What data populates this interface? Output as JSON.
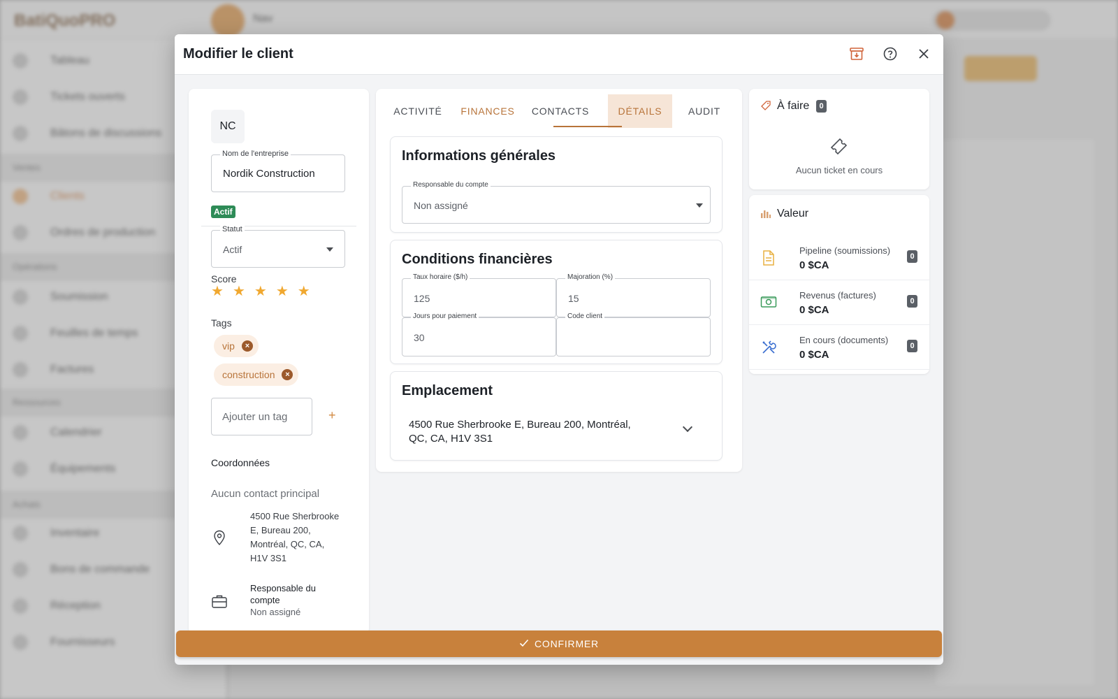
{
  "background": {
    "logo_text": "BatiQuoPRO",
    "top_text": "Nav",
    "nav_items": [
      "Tableau",
      "Tickets ouverts",
      "Bâtons de discussions",
      "Clients",
      "Ordres de production",
      "Soumission",
      "Feuilles de temps",
      "Factures",
      "Calendrier",
      "Équipements",
      "Inventaire",
      "Bons de commande",
      "Réception",
      "Fournisseurs"
    ],
    "nav_sections": [
      "Ventes",
      "Opérations",
      "Ressources",
      "Achats"
    ]
  },
  "modal": {
    "title": "Modifier le client",
    "header_icons": [
      "archive-icon",
      "help-icon",
      "close-icon"
    ]
  },
  "left": {
    "initials": "NC",
    "company_label": "Nom de l'entreprise",
    "company_value": "Nordik Construction",
    "status_badge": "Actif",
    "status_label": "Statut",
    "status_value": "Actif",
    "score_label": "Score",
    "score": 5,
    "tags_label": "Tags",
    "tags": [
      "vip",
      "construction"
    ],
    "tag_placeholder": "Ajouter un tag",
    "tag_add": "+",
    "coords_label": "Coordonnées",
    "no_contact": "Aucun contact principal",
    "address_lines": [
      "4500 Rue Sherbrooke",
      "E, Bureau 200,",
      "Montréal, QC, CA,",
      "H1V 3S1"
    ],
    "manager_label_lines": [
      "Responsable du",
      "compte"
    ],
    "manager_value": "Non assigné"
  },
  "tabs": [
    {
      "label": "ACTIVITÉ",
      "state": "normal"
    },
    {
      "label": "FINANCES",
      "state": "accent"
    },
    {
      "label": "CONTACTS",
      "state": "normal"
    },
    {
      "label": "DÉTAILS",
      "state": "active"
    },
    {
      "label": "AUDIT",
      "state": "normal"
    }
  ],
  "general": {
    "title": "Informations générales",
    "manager_label": "Responsable du compte",
    "manager_value": "Non assigné"
  },
  "finance": {
    "title": "Conditions financières",
    "hourly_label": "Taux horaire ($/h)",
    "hourly_value": "125",
    "markup_label": "Majoration (%)",
    "markup_value": "15",
    "payment_label": "Jours pour paiement",
    "payment_value": "30",
    "client_code_label": "Code client",
    "client_code_value": ""
  },
  "location": {
    "title": "Emplacement",
    "address_line1": "4500 Rue Sherbrooke E, Bureau 200, Montréal,",
    "address_line2": "QC, CA, H1V 3S1"
  },
  "todo": {
    "title": "À faire",
    "count": "0",
    "empty_text": "Aucun ticket en cours"
  },
  "value": {
    "title": "Valeur",
    "rows": [
      {
        "label": "Pipeline (soumissions)",
        "amount": "0 $CA",
        "count": "0",
        "icon": "document-icon",
        "color": "#e8b040"
      },
      {
        "label": "Revenus (factures)",
        "amount": "0 $CA",
        "count": "0",
        "icon": "money-icon",
        "color": "#3a9a5a"
      },
      {
        "label": "En cours (documents)",
        "amount": "0 $CA",
        "count": "0",
        "icon": "tools-icon",
        "color": "#3b6fd0"
      }
    ]
  },
  "footer": {
    "confirm_label": "CONFIRMER"
  },
  "colors": {
    "accent": "#c8813c",
    "accent_text": "#b8743a",
    "active_badge": "#2e8b57",
    "star": "#f0a830"
  }
}
